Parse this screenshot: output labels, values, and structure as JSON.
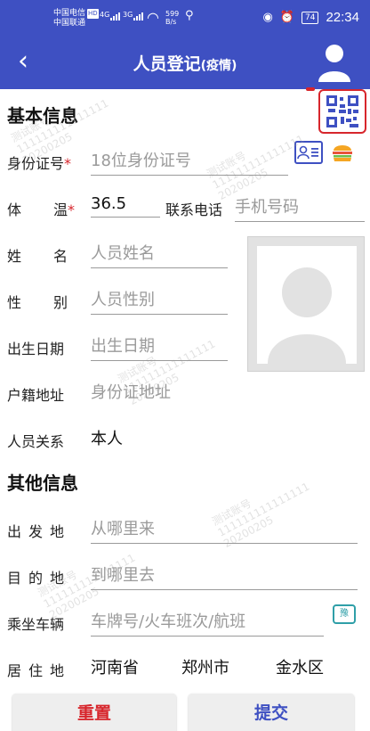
{
  "status_bar": {
    "carrier_1": "中国电信",
    "carrier_1_badge": "HD",
    "carrier_2": "中国联通",
    "signal_1": "4G",
    "signal_2": "3G",
    "net_speed_value": "599",
    "net_speed_unit": "B/s",
    "battery": "74",
    "time": "22:34"
  },
  "header": {
    "title": "人员登记",
    "title_suffix": "(疫情)"
  },
  "basic_section": {
    "title": "基本信息"
  },
  "fields": {
    "id_number": {
      "label": "身份证号",
      "placeholder": "18位身份证号"
    },
    "temperature": {
      "label_a": "体",
      "label_b": "温",
      "value": "36.5"
    },
    "phone": {
      "label": "联系电话",
      "placeholder": "手机号码"
    },
    "name": {
      "label_a": "姓",
      "label_b": "名",
      "placeholder": "人员姓名"
    },
    "gender": {
      "label_a": "性",
      "label_b": "别",
      "placeholder": "人员性别"
    },
    "birth_date": {
      "label": "出生日期",
      "placeholder": "出生日期"
    },
    "household_address": {
      "label": "户籍地址",
      "placeholder": "身份证地址"
    },
    "relation": {
      "label": "人员关系",
      "value": "本人"
    }
  },
  "required_mark": "*",
  "other_section": {
    "title": "其他信息"
  },
  "other_fields": {
    "departure": {
      "label_a": "出",
      "label_b": "发",
      "label_c": "地",
      "placeholder": "从哪里来"
    },
    "destination": {
      "label_a": "目",
      "label_b": "的",
      "label_c": "地",
      "placeholder": "到哪里去"
    },
    "vehicle": {
      "label": "乘坐车辆",
      "placeholder": "车牌号/火车班次/航班"
    },
    "residence": {
      "label_a": "居",
      "label_b": "住",
      "label_c": "地",
      "province": "河南省",
      "city": "郑州市",
      "district": "金水区"
    }
  },
  "buttons": {
    "reset": "重置",
    "submit": "提交"
  },
  "watermark": {
    "line1": "测试账号",
    "line2": "111111111111111",
    "line3": "20200205"
  },
  "colors": {
    "primary": "#3E50C2",
    "accent_red": "#D7262C"
  }
}
